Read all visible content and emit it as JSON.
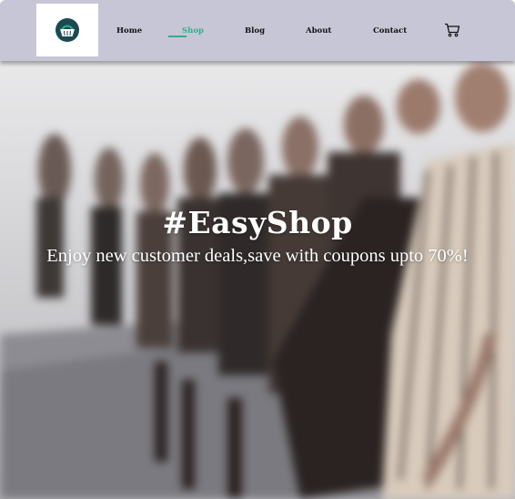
{
  "navbar": {
    "logo": "shopping-basket-icon",
    "links": [
      {
        "label": "Home",
        "active": false
      },
      {
        "label": "Shop",
        "active": true
      },
      {
        "label": "Blog",
        "active": false
      },
      {
        "label": "About",
        "active": false
      },
      {
        "label": "Contact",
        "active": false
      }
    ],
    "cart_icon": "cart-icon"
  },
  "hero": {
    "title": "#EasyShop",
    "subtitle": "Enjoy new customer deals,save with coupons upto 70%!"
  },
  "colors": {
    "navbar_bg": "#c7c6d6",
    "accent": "#2fae8c",
    "hero_text": "#ffffff"
  }
}
